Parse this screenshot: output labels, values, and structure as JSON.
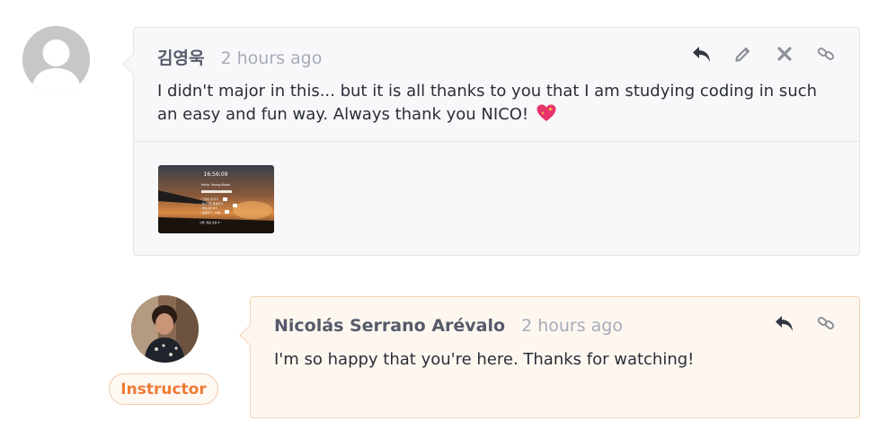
{
  "comments": [
    {
      "author": "김영욱",
      "time": "2 hours ago",
      "body": "I didn't major in this... but it is all thanks to you that I am studying coding in such an easy and fun way. Always thank you NICO!",
      "emoji_icon": "sparkling-heart-icon",
      "attachment": {
        "time_text": "16:56:09",
        "greeting": "Hello, Young-Wook",
        "todo_items": [
          "• 고양이 밥 주기",
          "• 웹사이트 완성하기",
          "• 영어공부 하기",
          "• 운동하기 - 30분"
        ],
        "footer": "서울, 맑음 흐림 8°"
      },
      "actions": [
        "reply-icon",
        "edit-icon",
        "delete-icon",
        "link-icon"
      ]
    },
    {
      "author": "Nicolás Serrano Arévalo",
      "time": "2 hours ago",
      "body": "I'm so happy that you're here. Thanks for watching!",
      "role_badge": "Instructor",
      "actions": [
        "reply-icon",
        "link-icon"
      ]
    }
  ],
  "colors": {
    "accent": "#ee7a36",
    "author_text": "#565b6b",
    "muted_text": "#a7abba",
    "action_icon": "#8c909a",
    "reply_icon": "#333641"
  }
}
